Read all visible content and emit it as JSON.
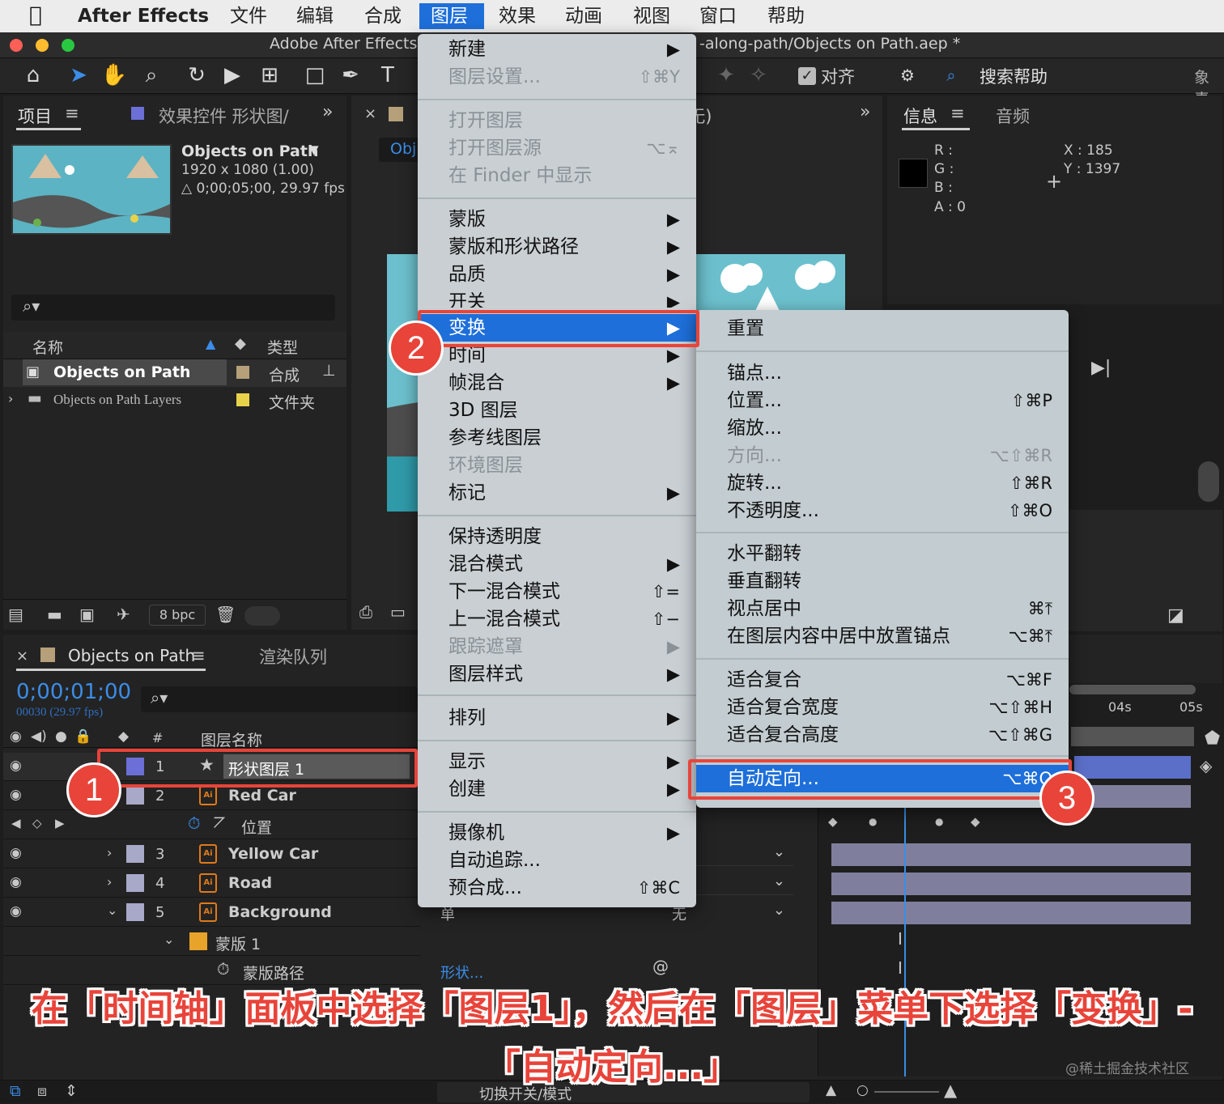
{
  "menubar": {
    "app": "After Effects",
    "items": [
      "文件",
      "编辑",
      "合成",
      "图层",
      "效果",
      "动画",
      "视图",
      "窗口",
      "帮助"
    ],
    "active_index": 3
  },
  "window": {
    "title_left": "Adobe After Effects",
    "title_right": "-along-path/Objects on Path.aep *"
  },
  "toolbar": {
    "snap_label": "对齐",
    "search_help": "搜索帮助",
    "right_clip": "象素"
  },
  "project_panel": {
    "tab": "项目",
    "effects_tab": "效果控件 形状图/",
    "comp_name": "Objects on Path",
    "comp_size": "1920 x 1080 (1.00)",
    "comp_duration": "△ 0;00;05;00, 29.97 fps",
    "col_name": "名称",
    "col_type": "类型",
    "items": [
      {
        "name": "Objects on Path",
        "type": "合成"
      },
      {
        "name": "Objects on Path Layers",
        "type": "文件夹"
      }
    ],
    "bpc": "8 bpc"
  },
  "comp_panel": {
    "tab_partial": "Obj",
    "right_header": "(无)"
  },
  "info_panel": {
    "tab_info": "信息",
    "tab_audio": "音频",
    "r": "R :",
    "g": "G :",
    "b": "B :",
    "a": "A :  0",
    "x": "X : 185",
    "y": "Y :  1397"
  },
  "timeline": {
    "tab": "Objects on Path",
    "render_tab": "渲染队列",
    "timecode": "0;00;01;00",
    "frame": "00030 (29.97 fps)",
    "col_layer_name": "图层名称",
    "col_num": "#",
    "ruler": [
      "04s",
      "05s"
    ],
    "layers": [
      {
        "num": "1",
        "name": "形状图层 1",
        "color": "#6b6fd6"
      },
      {
        "num": "2",
        "name": "Red Car",
        "color": "#a8a8c8"
      },
      {
        "num": "3",
        "name": "Yellow Car",
        "color": "#a8a8c8"
      },
      {
        "num": "4",
        "name": "Road",
        "color": "#a8a8c8"
      },
      {
        "num": "5",
        "name": "Background",
        "color": "#a8a8c8"
      }
    ],
    "position_label": "位置",
    "mask_label": "蒙版 1",
    "mask_path_label": "蒙版路径",
    "mask_path_value": "形状...",
    "mode_none": "无",
    "mode_single": "单",
    "toggle_label": "切换开关/模式"
  },
  "layer_menu": {
    "items": [
      {
        "label": "新建",
        "shortcut": "▶",
        "enabled": true
      },
      {
        "label": "图层设置...",
        "shortcut": "⇧⌘Y",
        "enabled": false
      },
      {
        "label": "打开图层",
        "shortcut": "",
        "enabled": false
      },
      {
        "label": "打开图层源",
        "shortcut": "⌥⌅",
        "enabled": false
      },
      {
        "label": "在 Finder 中显示",
        "shortcut": "",
        "enabled": false
      },
      {
        "label": "蒙版",
        "shortcut": "▶",
        "enabled": true
      },
      {
        "label": "蒙版和形状路径",
        "shortcut": "▶",
        "enabled": true
      },
      {
        "label": "品质",
        "shortcut": "▶",
        "enabled": true
      },
      {
        "label": "开关",
        "shortcut": "▶",
        "enabled": true
      },
      {
        "label": "变换",
        "shortcut": "▶",
        "enabled": true
      },
      {
        "label": "时间",
        "shortcut": "▶",
        "enabled": true
      },
      {
        "label": "帧混合",
        "shortcut": "▶",
        "enabled": true
      },
      {
        "label": "3D 图层",
        "shortcut": "",
        "enabled": true
      },
      {
        "label": "参考线图层",
        "shortcut": "",
        "enabled": true
      },
      {
        "label": "环境图层",
        "shortcut": "",
        "enabled": false
      },
      {
        "label": "标记",
        "shortcut": "▶",
        "enabled": true
      },
      {
        "label": "保持透明度",
        "shortcut": "",
        "enabled": true
      },
      {
        "label": "混合模式",
        "shortcut": "▶",
        "enabled": true
      },
      {
        "label": "下一混合模式",
        "shortcut": "⇧=",
        "enabled": true
      },
      {
        "label": "上一混合模式",
        "shortcut": "⇧−",
        "enabled": true
      },
      {
        "label": "跟踪遮罩",
        "shortcut": "▶",
        "enabled": false
      },
      {
        "label": "图层样式",
        "shortcut": "▶",
        "enabled": true
      },
      {
        "label": "排列",
        "shortcut": "▶",
        "enabled": true
      },
      {
        "label": "显示",
        "shortcut": "▶",
        "enabled": true
      },
      {
        "label": "创建",
        "shortcut": "▶",
        "enabled": true
      },
      {
        "label": "摄像机",
        "shortcut": "▶",
        "enabled": true
      },
      {
        "label": "自动追踪...",
        "shortcut": "",
        "enabled": true
      },
      {
        "label": "预合成...",
        "shortcut": "⇧⌘C",
        "enabled": true
      }
    ]
  },
  "transform_menu": {
    "items": [
      {
        "label": "重置",
        "shortcut": "",
        "enabled": true
      },
      {
        "label": "锚点...",
        "shortcut": "",
        "enabled": true
      },
      {
        "label": "位置...",
        "shortcut": "⇧⌘P",
        "enabled": true
      },
      {
        "label": "缩放...",
        "shortcut": "",
        "enabled": true
      },
      {
        "label": "方向...",
        "shortcut": "⌥⇧⌘R",
        "enabled": false
      },
      {
        "label": "旋转...",
        "shortcut": "⇧⌘R",
        "enabled": true
      },
      {
        "label": "不透明度...",
        "shortcut": "⇧⌘O",
        "enabled": true
      },
      {
        "label": "水平翻转",
        "shortcut": "",
        "enabled": true
      },
      {
        "label": "垂直翻转",
        "shortcut": "",
        "enabled": true
      },
      {
        "label": "视点居中",
        "shortcut": "⌘⤒",
        "enabled": true
      },
      {
        "label": "在图层内容中居中放置锚点",
        "shortcut": "⌥⌘⤒",
        "enabled": true
      },
      {
        "label": "适合复合",
        "shortcut": "⌥⌘F",
        "enabled": true
      },
      {
        "label": "适合复合宽度",
        "shortcut": "⌥⇧⌘H",
        "enabled": true
      },
      {
        "label": "适合复合高度",
        "shortcut": "⌥⇧⌘G",
        "enabled": true
      },
      {
        "label": "自动定向...",
        "shortcut": "⌥⌘O",
        "enabled": true
      }
    ]
  },
  "annotations": {
    "badges": [
      "1",
      "2",
      "3"
    ],
    "caption_line1": "在「时间轴」面板中选择「图层1」，然后在「图层」菜单下选择「变换」-",
    "caption_line2": "「自动定向...」",
    "watermark": "@稀土掘金技术社区"
  },
  "colors": {
    "accent": "#1e6fd9",
    "annotation": "#e8443a",
    "timecode": "#3b8de8"
  }
}
